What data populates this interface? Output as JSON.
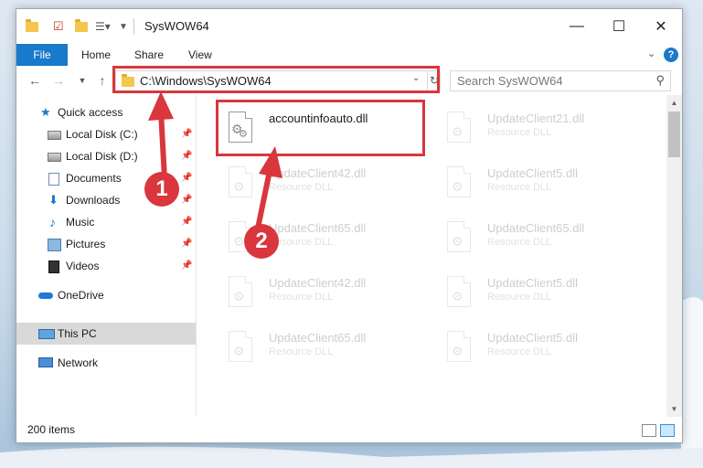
{
  "window": {
    "title": "SysWOW64",
    "controls": {
      "minimize": "—",
      "maximize": "☐",
      "close": "✕"
    }
  },
  "ribbon": {
    "tabs": [
      "File",
      "Home",
      "Share",
      "View"
    ],
    "help": "?"
  },
  "address": {
    "path": "C:\\Windows\\SysWOW64",
    "search_placeholder": "Search SysWOW64"
  },
  "sidebar": {
    "items": [
      {
        "label": "Quick access",
        "icon": "star-icon",
        "pinned": false
      },
      {
        "label": "Local Disk (C:)",
        "icon": "drive-icon",
        "pinned": true
      },
      {
        "label": "Local Disk (D:)",
        "icon": "drive-icon",
        "pinned": true
      },
      {
        "label": "Documents",
        "icon": "documents-icon",
        "pinned": true
      },
      {
        "label": "Downloads",
        "icon": "download-icon",
        "pinned": true
      },
      {
        "label": "Music",
        "icon": "music-icon",
        "pinned": true
      },
      {
        "label": "Pictures",
        "icon": "pictures-icon",
        "pinned": true
      },
      {
        "label": "Videos",
        "icon": "videos-icon",
        "pinned": true
      },
      {
        "label": "OneDrive",
        "icon": "onedrive-icon",
        "pinned": false
      },
      {
        "label": "This PC",
        "icon": "pc-icon",
        "pinned": false,
        "selected": true
      },
      {
        "label": "Network",
        "icon": "network-icon",
        "pinned": false
      }
    ]
  },
  "files": [
    {
      "name": "accountinfoauto.dll",
      "type": "",
      "highlighted": true
    },
    {
      "name": "UpdateClient21.dll",
      "type": "Resource DLL"
    },
    {
      "name": "UpdateClient42.dll",
      "type": "Resource DLL"
    },
    {
      "name": "UpdateClient5.dll",
      "type": "Resource DLL"
    },
    {
      "name": "UpdateClient65.dll",
      "type": "Resource DLL"
    },
    {
      "name": "UpdateClient65.dll",
      "type": "Resource DLL"
    },
    {
      "name": "UpdateClient42.dll",
      "type": "Resource DLL"
    },
    {
      "name": "UpdateClient5.dll",
      "type": "Resource DLL"
    },
    {
      "name": "UpdateClient65.dll",
      "type": "Resource DLL"
    },
    {
      "name": "UpdateClient5.dll",
      "type": "Resource DLL"
    }
  ],
  "status": {
    "item_count": "200 items"
  },
  "annotations": {
    "step1": "1",
    "step2": "2",
    "color": "#d9363e"
  }
}
